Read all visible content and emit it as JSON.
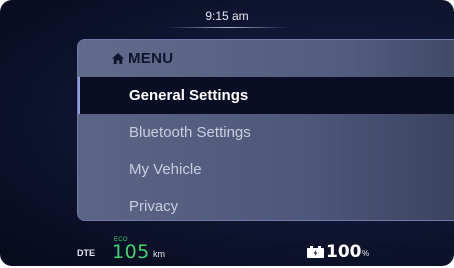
{
  "status_bar": {
    "time": "9:15 am"
  },
  "menu": {
    "title": "MENU",
    "header_icon": "home-icon",
    "selected_index": 0,
    "items": [
      {
        "label": "General Settings"
      },
      {
        "label": "Bluetooth Settings"
      },
      {
        "label": "My Vehicle"
      },
      {
        "label": "Privacy"
      }
    ]
  },
  "bottom_bar": {
    "dte_label": "DTE",
    "eco_label": "ECO",
    "range_value": "105",
    "range_unit": "km",
    "battery_icon": "battery-icon",
    "battery_value": "100",
    "battery_unit": "%"
  },
  "colors": {
    "background": "#0b1028",
    "menu_panel": "#555e80",
    "selected_item": "#0a0e24",
    "eco_green": "#3fd26f",
    "text_light": "#e3e6f0"
  }
}
